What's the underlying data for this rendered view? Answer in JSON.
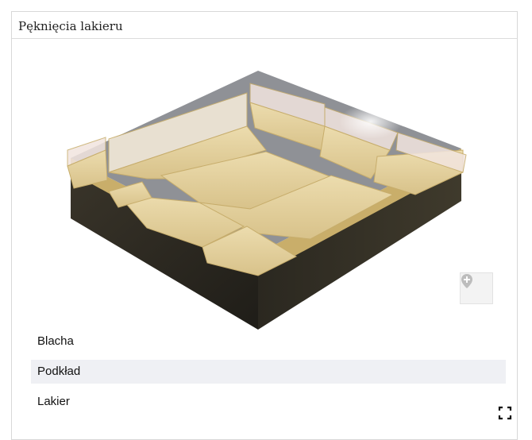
{
  "panel": {
    "title": "Pęknięcia lakieru"
  },
  "layers": [
    {
      "label": "Blacha",
      "selected": false
    },
    {
      "label": "Podkład",
      "selected": true
    },
    {
      "label": "Lakier",
      "selected": false
    }
  ],
  "icons": {
    "pin": "map-pin-plus-icon",
    "fullscreen": "fullscreen-icon"
  },
  "colors": {
    "substrate": "#2e2b22",
    "primer": "#d8c28a",
    "lacquer_top": "#e2d2a3",
    "gap": "#8a8d93",
    "selected_bg": "#eff0f4"
  }
}
